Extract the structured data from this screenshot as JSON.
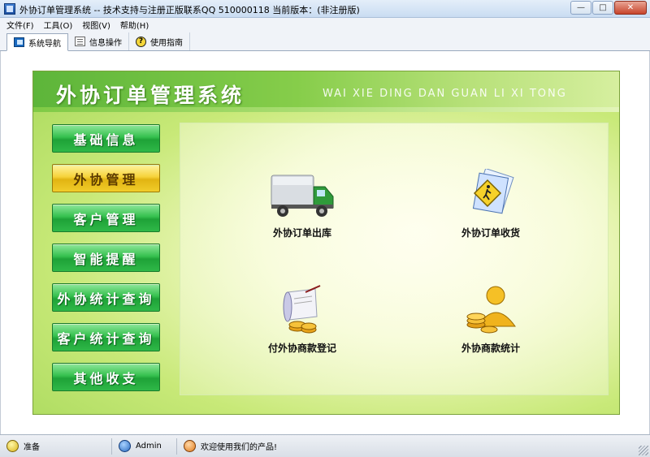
{
  "window": {
    "title": "外协订单管理系统 -- 技术支持与注册正版联系QQ 510000118   当前版本：(非注册版)"
  },
  "menu": [
    "文件(F)",
    "工具(O)",
    "视图(V)",
    "帮助(H)"
  ],
  "tabs": [
    {
      "label": "系统导航",
      "icon": "nav-icon"
    },
    {
      "label": "信息操作",
      "icon": "info-icon"
    },
    {
      "label": "使用指南",
      "icon": "help-icon"
    }
  ],
  "panel": {
    "title": "外协订单管理系统",
    "pinyin": "WAI XIE DING DAN GUAN LI XI TONG"
  },
  "nav": [
    "基础信息",
    "外协管理",
    "客户管理",
    "智能提醒",
    "外协统计查询",
    "客户统计查询",
    "其他收支"
  ],
  "features": [
    {
      "label": "外协订单出库",
      "icon": "truck-icon"
    },
    {
      "label": "外协订单收货",
      "icon": "folder-pedestrian-icon"
    },
    {
      "label": "付外协商款登记",
      "icon": "scroll-coins-icon"
    },
    {
      "label": "外协商款统计",
      "icon": "person-coins-icon"
    }
  ],
  "status": {
    "ready": "准备",
    "user": "Admin",
    "welcome": "欢迎使用我们的产品!"
  }
}
